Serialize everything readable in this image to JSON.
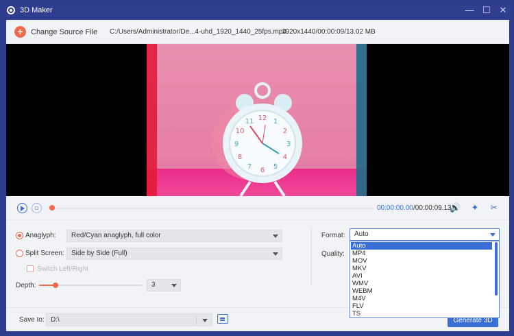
{
  "window": {
    "title": "3D Maker",
    "minimize_label": "—",
    "maximize_label": "☐",
    "close_label": "✕"
  },
  "topbar": {
    "add_icon": "plus-circle-icon",
    "add_label": "+",
    "change_source_label": "Change Source File",
    "file_path": "C:/Users/Administrator/De...4-uhd_1920_1440_25fps.mp4",
    "file_info": "1920x1440/00:00:09/13.02 MB"
  },
  "preview": {
    "clock_numbers": [
      "12",
      "1",
      "2",
      "3",
      "4",
      "5",
      "6",
      "7",
      "8",
      "9",
      "10",
      "11"
    ]
  },
  "playback": {
    "progress": 0.0,
    "current_time": "00:00:00.00",
    "total_time": "/00:00:09.13"
  },
  "settings": {
    "anaglyph_label": "Anaglyph:",
    "anaglyph_value": "Red/Cyan anaglyph, full color",
    "anaglyph_selected": true,
    "split_screen_label": "Split Screen:",
    "split_screen_value": "Side by Side (Full)",
    "split_screen_selected": false,
    "switch_label": "Switch Left/Right",
    "switch_checked": false,
    "depth_label": "Depth:",
    "depth_value": "3",
    "depth_level": 0.16,
    "format_label": "Format:",
    "format_value": "Auto",
    "quality_label": "Quality:",
    "format_options": [
      "Auto",
      "MP4",
      "MOV",
      "MKV",
      "AVI",
      "WMV",
      "WEBM",
      "M4V",
      "FLV",
      "TS"
    ]
  },
  "bottom": {
    "save_label": "Save to:",
    "save_path": "D:\\",
    "generate_label": "Generate 3D"
  },
  "colors": {
    "accent": "#f26a4b",
    "brand_blue": "#3b6fd8",
    "titlebar": "#2f3e8f"
  }
}
